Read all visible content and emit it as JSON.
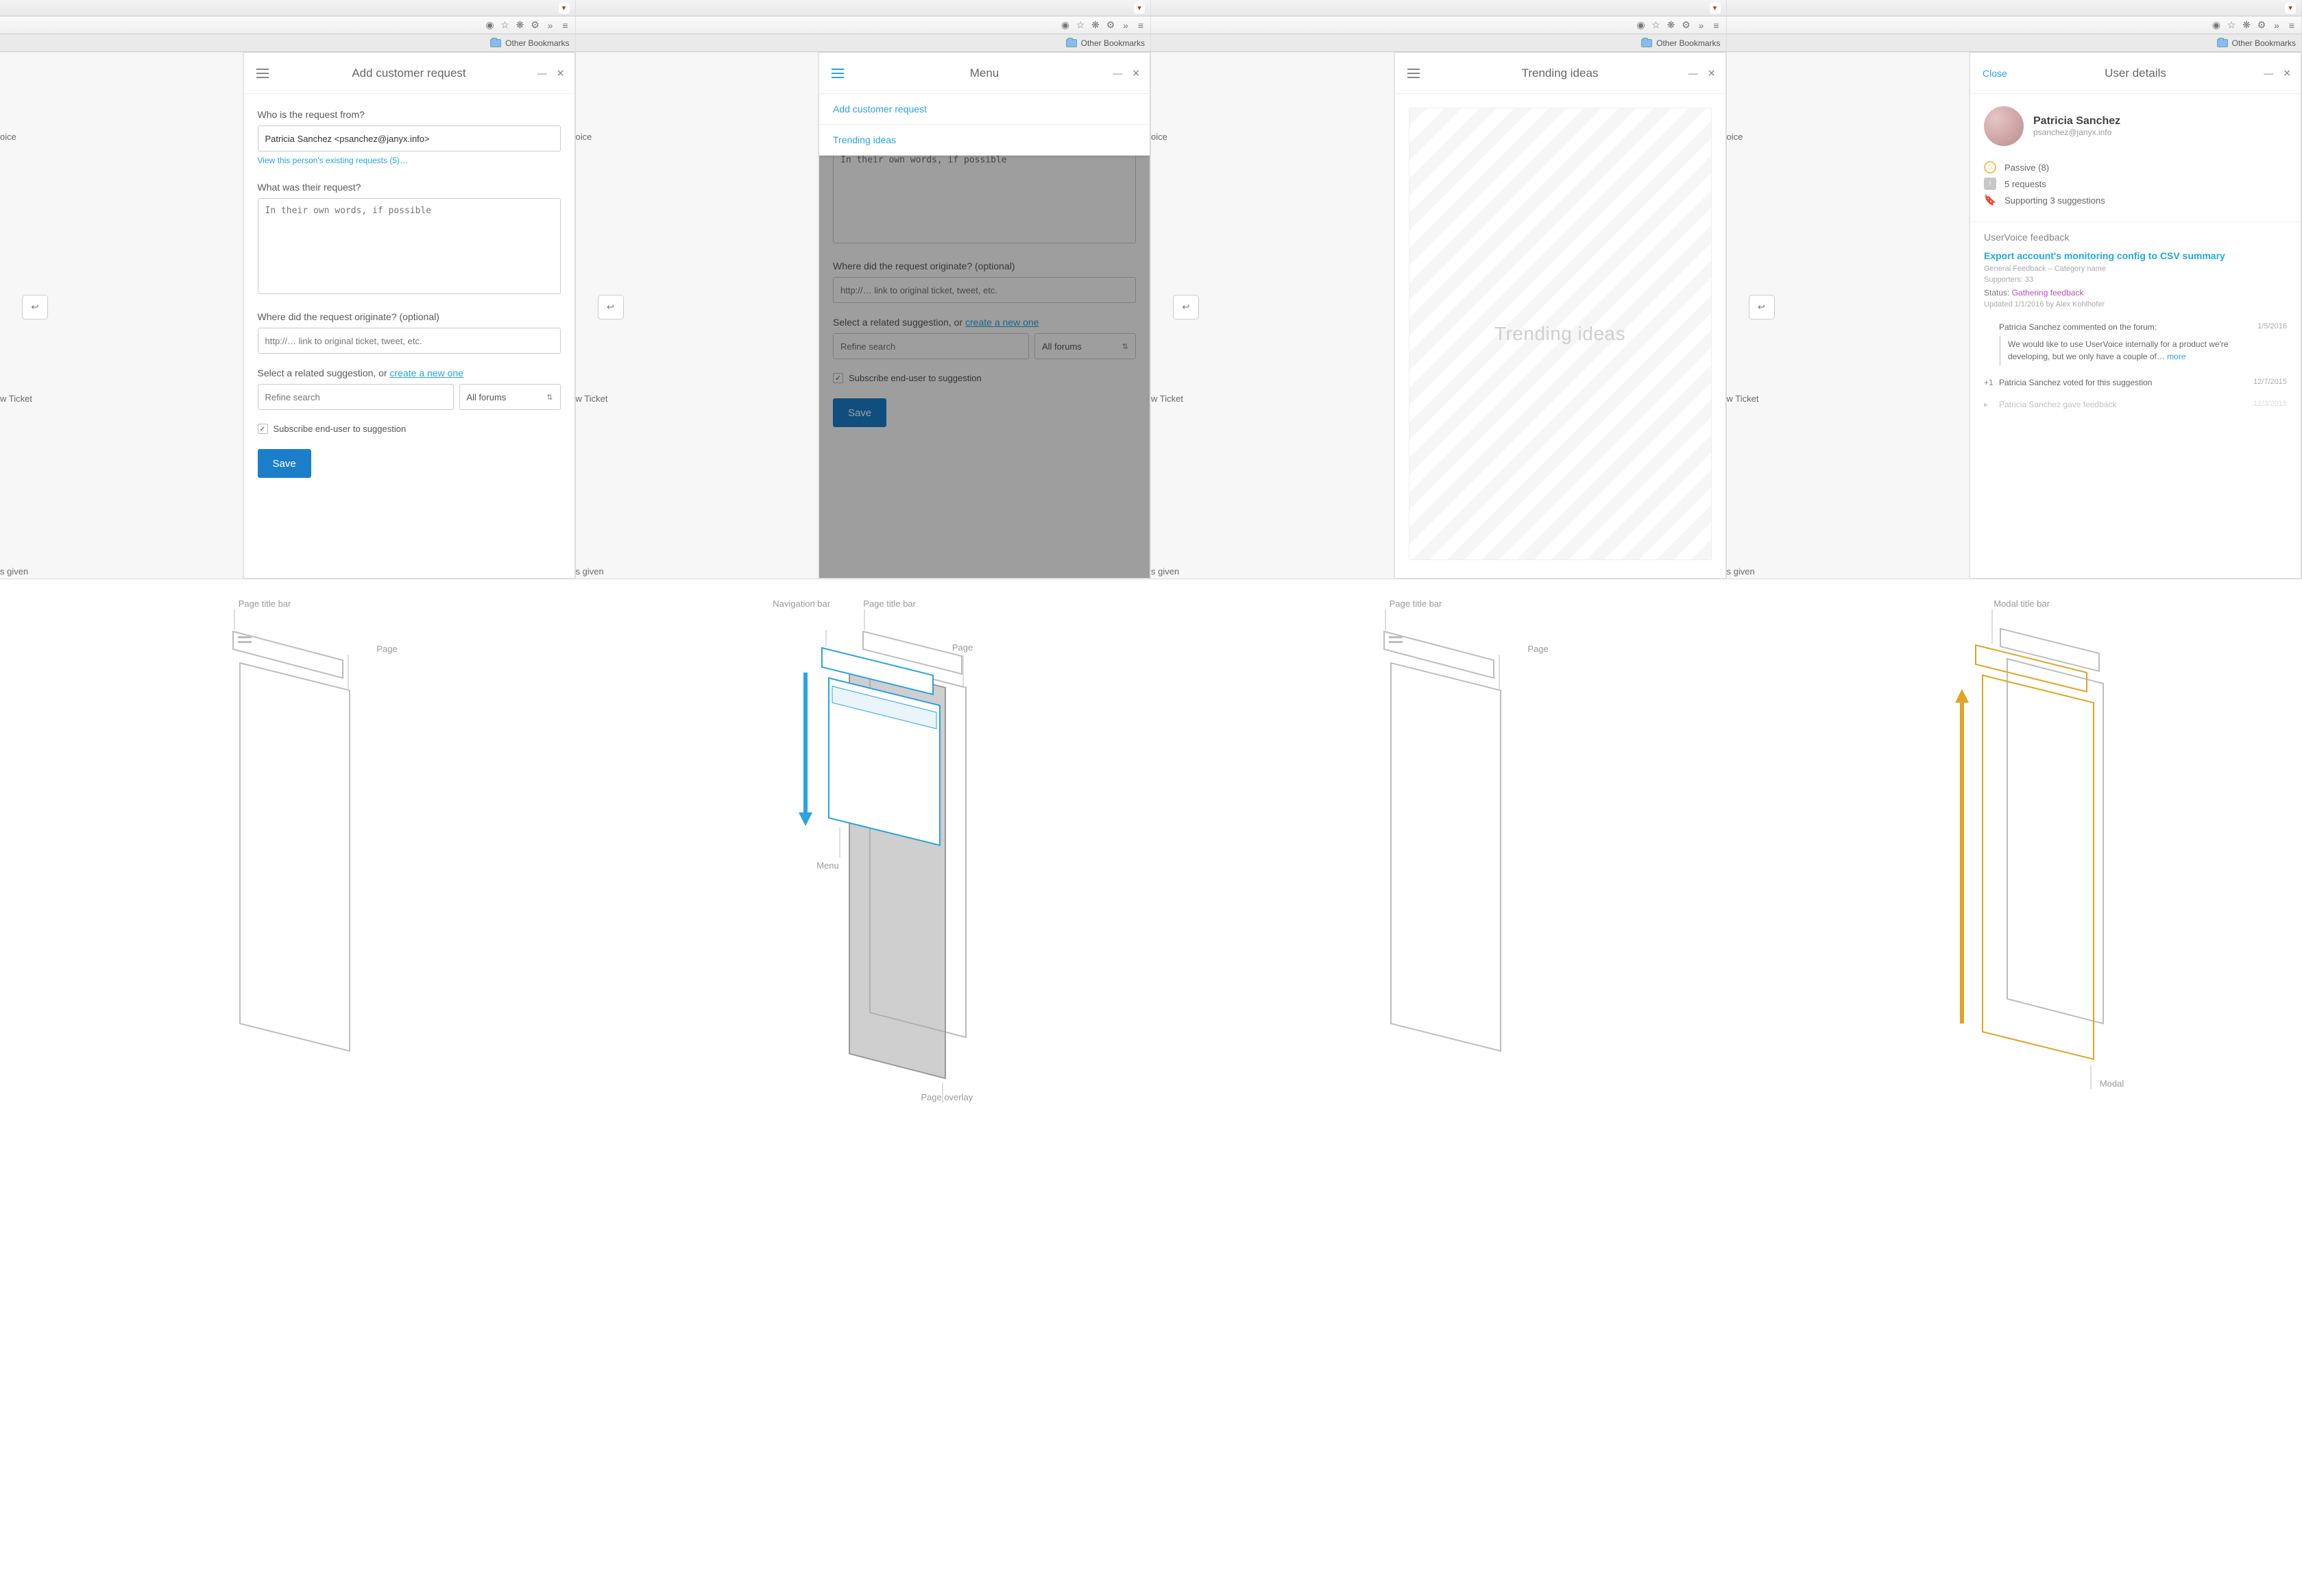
{
  "browser": {
    "other_bookmarks": "Other Bookmarks",
    "chevrons": "»"
  },
  "underlying": {
    "oice_fragment": "oice",
    "new_ticket_fragment": "w Ticket",
    "s_given_fragment": "s given"
  },
  "panel1": {
    "title": "Add customer request",
    "q_from": "Who is the request from?",
    "from_value": "Patricia Sanchez <psanchez@janyx.info>",
    "existing_link": "View this person's existing requests (5)…",
    "q_what": "What was their request?",
    "what_ph": "In their own words, if possible",
    "q_orig": "Where did the request originate? (optional)",
    "orig_ph": "http://… link to original ticket, tweet, etc.",
    "related_prefix": "Select a related suggestion, or ",
    "related_link": "create a new one",
    "refine_ph": "Refine search",
    "dd_label": "All forums",
    "subscribe": "Subscribe end-user to suggestion",
    "save": "Save"
  },
  "panel2": {
    "title": "Menu",
    "item1": "Add customer request",
    "item2": "Trending ideas"
  },
  "panel3": {
    "title": "Trending ideas",
    "ph": "Trending ideas"
  },
  "panel4": {
    "title": "User details",
    "close": "Close",
    "name": "Patricia Sanchez",
    "email": "psanchez@janyx.info",
    "passive": "Passive (8)",
    "requests": "5 requests",
    "supporting": "Supporting 3 suggestions",
    "fb_label": "UserVoice feedback",
    "fb_title": "Export account's monitoring config to CSV summary",
    "fb_meta": "General Feedback – Category name",
    "fb_supporters": "Supporters: 33",
    "fb_status_lbl": "Status:",
    "fb_status_val": "Gathering feedback",
    "fb_updated": "Updated 1/1/2016 by Alex Kohlhofer",
    "act1_head": "Patricia Sanchez commented on the forum:",
    "act1_date": "1/5/2016",
    "act1_body": "We would like to use UserVoice internally for a product we're developing, but we only have a couple of… ",
    "act1_more": "more",
    "act2": "Patricia Sanchez voted for this suggestion",
    "act2_date": "12/7/2015",
    "act3": "Patricia Sanchez gave feedback",
    "act3_date": "12/3/2015"
  },
  "diagrams": {
    "d1": {
      "page_title_bar": "Page title bar",
      "page": "Page"
    },
    "d2": {
      "page_title_bar": "Page title bar",
      "nav_bar": "Navigation bar",
      "page": "Page",
      "menu": "Menu",
      "page_overlay": "Page overlay"
    },
    "d3": {
      "page_title_bar": "Page title bar",
      "page": "Page"
    },
    "d4": {
      "modal_title_bar": "Modal title bar",
      "modal": "Modal"
    }
  }
}
